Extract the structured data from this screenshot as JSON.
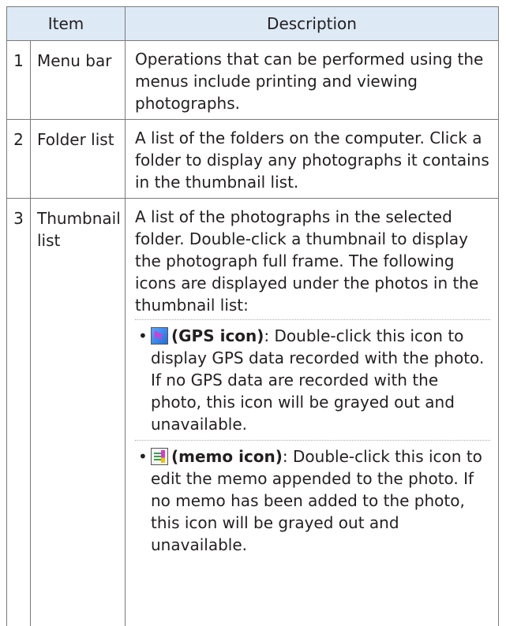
{
  "table": {
    "header": {
      "item": "Item",
      "description": "Description"
    },
    "rows": [
      {
        "num": "1",
        "item": "Menu bar",
        "description": "Operations that can be performed using the menus include printing and viewing photographs."
      },
      {
        "num": "2",
        "item": "Folder list",
        "description": "A list of the folders on the computer. Click a folder to display any photographs it contains in the thumbnail list."
      },
      {
        "num": "3",
        "item": "Thumbnail list",
        "description": "A list of the photographs in the selected folder. Double-click a thumbnail to display the photograph full frame. The following icons are displayed under the photos in the thumbnail list:",
        "bullets": [
          {
            "icon": "gps-icon",
            "term": "(GPS icon)",
            "text": ": Double-click this icon to display GPS data recorded with the photo. If no GPS data are recorded with the photo, this icon will be grayed out and unavailable."
          },
          {
            "icon": "memo-icon",
            "term": "(memo icon)",
            "text": ": Double-click this icon to edit the memo appended to the photo. If no memo has been added to the photo, this icon will be grayed out and unavailable."
          }
        ]
      }
    ]
  }
}
